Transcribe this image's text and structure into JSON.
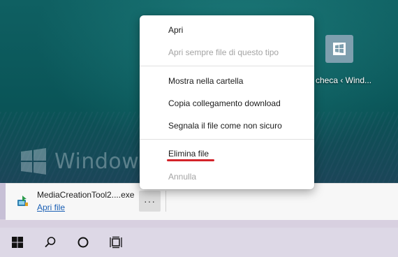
{
  "desktop": {
    "watermark_text": "Windows",
    "shortcut_label": "checa ‹ Wind...",
    "shortcut_icon": "windows-store-app-icon"
  },
  "context_menu": {
    "items": [
      {
        "label": "Apri",
        "enabled": true
      },
      {
        "label": "Apri sempre file di questo tipo",
        "enabled": false
      },
      {
        "label": "Mostra nella cartella",
        "enabled": true
      },
      {
        "label": "Copia collegamento download",
        "enabled": true
      },
      {
        "label": "Segnala il file come non sicuro",
        "enabled": true
      },
      {
        "label": "Elimina file",
        "enabled": true,
        "highlighted_with_red_underline": true
      },
      {
        "label": "Annulla",
        "enabled": false
      }
    ]
  },
  "download_bar": {
    "filename": "MediaCreationTool2....exe",
    "open_link": "Apri file",
    "more_button_label": "···",
    "file_icon": "installer-file-icon"
  },
  "taskbar": {
    "icons": [
      "windows-start-icon",
      "search-icon",
      "cortana-circle-icon",
      "task-view-icon"
    ]
  },
  "colors": {
    "highlight_underline": "#d3232a",
    "link": "#1a5fb4",
    "disabled_text": "#a4a4a4"
  }
}
